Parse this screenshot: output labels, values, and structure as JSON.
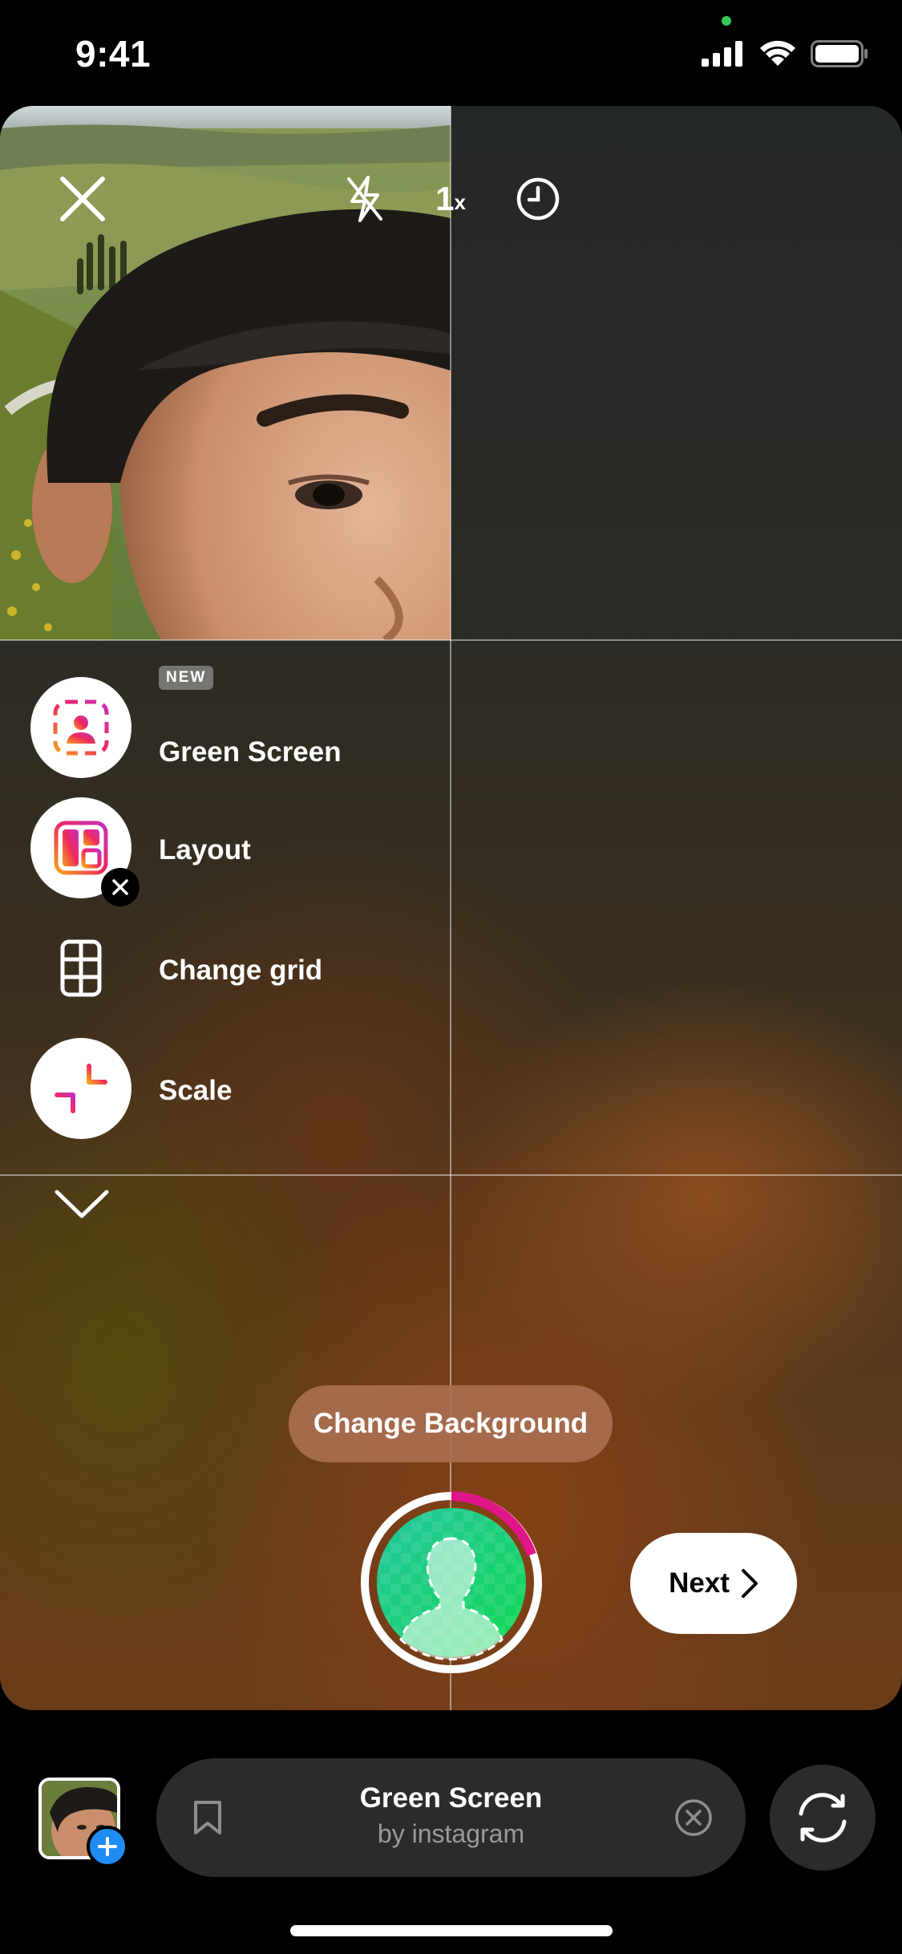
{
  "status_bar": {
    "time": "9:41"
  },
  "camera": {
    "controls": {
      "close_icon": "close-icon",
      "flash_icon": "flash-off-icon",
      "zoom_label": "1",
      "zoom_suffix": "x",
      "timer_icon": "timer-icon"
    },
    "menu": {
      "items": [
        {
          "label": "Green Screen",
          "badge": "NEW",
          "icon": "green-screen-icon"
        },
        {
          "label": "Layout",
          "icon": "layout-icon"
        },
        {
          "label": "Change grid",
          "icon": "grid-icon"
        },
        {
          "label": "Scale",
          "icon": "scale-icon"
        }
      ],
      "collapse_icon": "chevron-down-icon"
    },
    "change_background_label": "Change Background",
    "next_label": "Next",
    "colors": {
      "accent_pink": "#e1158a",
      "shutter_green": "#1fd36a",
      "next_bg": "#ffffff"
    }
  },
  "bottom_bar": {
    "effect_title": "Green Screen",
    "effect_author": "by instagram",
    "save_icon": "bookmark-icon",
    "remove_icon": "close-circle-icon",
    "flip_icon": "flip-camera-icon"
  }
}
